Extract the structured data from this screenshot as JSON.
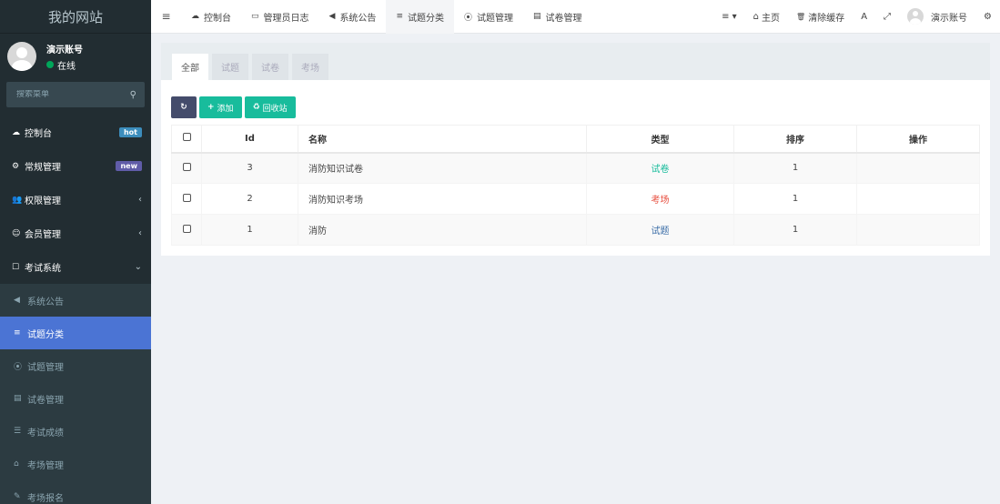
{
  "sidebar": {
    "logo": "我的网站",
    "user": {
      "name": "演示账号",
      "status": "在线"
    },
    "search_placeholder": "搜索菜单",
    "items": [
      {
        "icon": "☁",
        "label": "控制台",
        "badge": "hot"
      },
      {
        "icon": "⚙",
        "label": "常规管理",
        "badge": "new"
      },
      {
        "icon": "👥",
        "label": "权限管理",
        "chevron": "‹"
      },
      {
        "icon": "☺",
        "label": "会员管理",
        "chevron": "‹"
      },
      {
        "icon": "☐",
        "label": "考试系统",
        "chevron": "⌄"
      }
    ],
    "sub_items": [
      {
        "icon": "◀",
        "label": "系统公告"
      },
      {
        "icon": "≡",
        "label": "试题分类"
      },
      {
        "icon": "⦿",
        "label": "试题管理"
      },
      {
        "icon": "▤",
        "label": "试卷管理"
      },
      {
        "icon": "☰",
        "label": "考试成绩"
      },
      {
        "icon": "⌂",
        "label": "考场管理"
      },
      {
        "icon": "✎",
        "label": "考场报名"
      }
    ]
  },
  "topbar": {
    "toggle_icon": "≡",
    "tabs": [
      {
        "icon": "☁",
        "label": "控制台"
      },
      {
        "icon": "▭",
        "label": "管理员日志"
      },
      {
        "icon": "◀",
        "label": "系统公告"
      },
      {
        "icon": "≡",
        "label": "试题分类"
      },
      {
        "icon": "⦿",
        "label": "试题管理"
      },
      {
        "icon": "▤",
        "label": "试卷管理"
      }
    ],
    "right": {
      "menu_icon": "≡ ▾",
      "home_icon": "⌂",
      "home": "主页",
      "clear_icon": "🗑",
      "clear_cache": "清除缓存",
      "lang_icon": "A",
      "fullscreen_icon": "⤢",
      "account": "演示账号",
      "settings_icon": "⚙"
    }
  },
  "panel": {
    "tabs": [
      "全部",
      "试题",
      "试卷",
      "考场"
    ],
    "buttons": {
      "refresh_icon": "↻",
      "add_icon": "+",
      "add": "添加",
      "recycle_icon": "♻",
      "recycle": "回收站"
    },
    "columns": [
      "Id",
      "名称",
      "类型",
      "排序",
      "操作"
    ],
    "rows": [
      {
        "id": "3",
        "name": "消防知识试卷",
        "type": "试卷",
        "sort": "1"
      },
      {
        "id": "2",
        "name": "消防知识考场",
        "type": "考场",
        "sort": "1"
      },
      {
        "id": "1",
        "name": "消防",
        "type": "试题",
        "sort": "1"
      }
    ]
  },
  "colors": {
    "sidebar_bg": "#222d32",
    "active_item": "#4b74d4",
    "teal": "#18bc9c",
    "red": "#e74c3c"
  }
}
